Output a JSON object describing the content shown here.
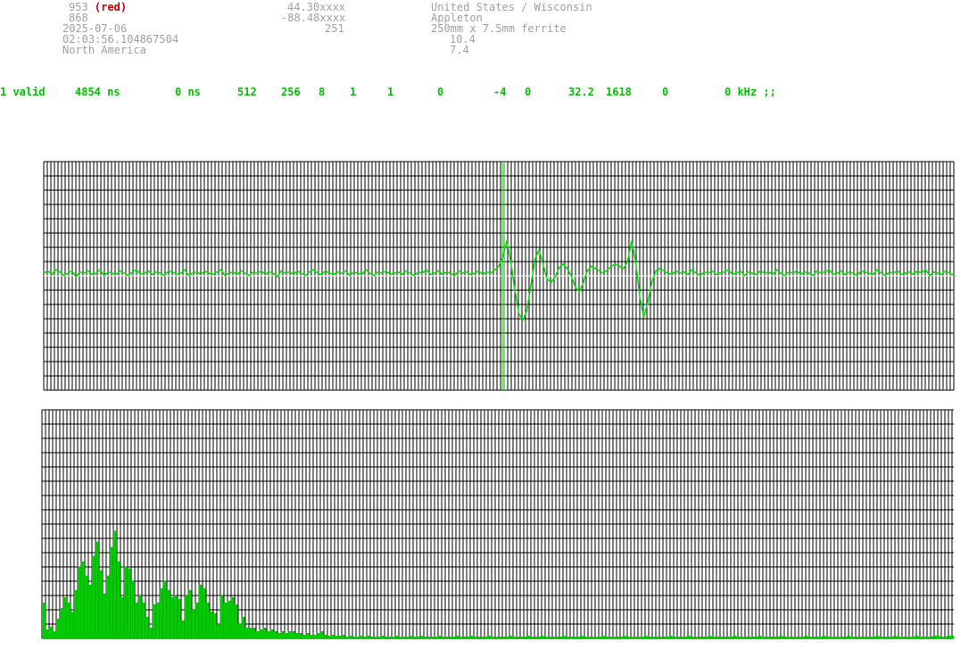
{
  "info": {
    "col1": [
      "953",
      "868",
      "2025-07-06",
      "02:03:56.104867504",
      "North America"
    ],
    "col1_flag": "(red)",
    "col2": [
      "44.30xxxx",
      "-88.48xxxx",
      "251"
    ],
    "col3": [
      "United States / Wisconsin",
      "Appleton",
      "250mm x 7.5mm ferrite",
      "10.4",
      "7.4"
    ]
  },
  "status": [
    "1 valid",
    "4854 ns",
    "0 ns",
    "512",
    "256",
    "8",
    "1",
    "1",
    "0",
    "-4",
    "0",
    "32.2",
    "1618",
    "0",
    "0 kHz ;;"
  ],
  "colors": {
    "grid": "#000000",
    "signal": "#00dd00",
    "bar": "#00cc00",
    "info": "#a0a0a0",
    "status": "#00c000",
    "flag": "#cc0000"
  },
  "waveform": {
    "samples": [
      0,
      2,
      -1,
      3,
      1,
      -2,
      0,
      2,
      -3,
      1,
      0,
      2,
      -1,
      0,
      3,
      -2,
      1,
      0,
      -1,
      2,
      0,
      -2,
      1,
      3,
      -1,
      0,
      2,
      -1,
      1,
      0,
      -2,
      2,
      1,
      -1,
      0,
      3,
      -2,
      0,
      1,
      -1,
      2,
      0,
      -1,
      1,
      3,
      -2,
      0,
      1,
      -1,
      2,
      0,
      -2,
      1,
      0,
      2,
      -1,
      1,
      0,
      -3,
      2,
      0,
      1,
      -1,
      2,
      0,
      -2,
      1,
      3,
      0,
      -1,
      2,
      0,
      -1,
      1,
      0,
      2,
      -2,
      1,
      0,
      -1,
      3,
      0,
      -2,
      1,
      0,
      2,
      -1,
      0,
      1,
      -1,
      2,
      0,
      -2,
      1,
      0,
      3,
      -1,
      0,
      2,
      -1,
      1,
      0,
      -2,
      2,
      0,
      1,
      -1,
      0,
      2,
      -1,
      1,
      0,
      3,
      6,
      14,
      28,
      10,
      -15,
      -35,
      -40,
      -32,
      -10,
      12,
      20,
      8,
      -5,
      -8,
      -3,
      5,
      8,
      4,
      -2,
      -12,
      -16,
      -8,
      2,
      6,
      4,
      2,
      0,
      3,
      6,
      8,
      6,
      4,
      10,
      28,
      10,
      -20,
      -38,
      -25,
      -8,
      2,
      4,
      2,
      0,
      -1,
      2,
      0,
      1,
      -1,
      3,
      0,
      -2,
      1,
      0,
      2,
      -1,
      0,
      1,
      3,
      -1,
      0,
      2,
      -2,
      1,
      0,
      -1,
      2,
      0,
      1,
      -1,
      3,
      0,
      -2,
      1,
      0,
      2,
      -1,
      1,
      0,
      -2,
      2,
      0,
      1,
      3,
      -1,
      0,
      2,
      -1,
      1,
      0,
      -2,
      2,
      1,
      0,
      -1,
      3,
      0,
      -2,
      1,
      0,
      2,
      -1,
      0,
      1,
      -1,
      2,
      0,
      3,
      -2,
      1,
      0,
      -1,
      2,
      0,
      -2
    ],
    "marker_fraction": 0.505
  },
  "spectrum": {
    "values": [
      40,
      10,
      13,
      8,
      22,
      34,
      46,
      40,
      30,
      54,
      80,
      86,
      70,
      60,
      92,
      108,
      76,
      50,
      70,
      102,
      120,
      86,
      46,
      80,
      78,
      64,
      40,
      48,
      40,
      24,
      12,
      38,
      40,
      56,
      64,
      54,
      46,
      48,
      44,
      20,
      48,
      54,
      32,
      40,
      60,
      56,
      40,
      30,
      28,
      16,
      48,
      40,
      42,
      46,
      38,
      16,
      24,
      12,
      12,
      12,
      8,
      10,
      12,
      8,
      10,
      8,
      6,
      8,
      6,
      8,
      8,
      6,
      6,
      4,
      6,
      4,
      4,
      6,
      8,
      4,
      3,
      4,
      3,
      3,
      4,
      2,
      3,
      2,
      2,
      3,
      2,
      3,
      2,
      2,
      2,
      3,
      2,
      2,
      2,
      3,
      2,
      2,
      2,
      3,
      2,
      2,
      3,
      2,
      2,
      2,
      2,
      3,
      2,
      2,
      2,
      2,
      3,
      2,
      2,
      2,
      3,
      2,
      2,
      2,
      2,
      3,
      2,
      2,
      2,
      2,
      2,
      3,
      2,
      2,
      2,
      2,
      3,
      2,
      2,
      2,
      3,
      2,
      2,
      2,
      2,
      2,
      3,
      2,
      2,
      2,
      2,
      3,
      2,
      2,
      2,
      2,
      2,
      3,
      2,
      2,
      2,
      2,
      2,
      3,
      2,
      2,
      2,
      2,
      2,
      3,
      2,
      2,
      2,
      2,
      2,
      2,
      3,
      2,
      2,
      2,
      2,
      3,
      2,
      2,
      2,
      2,
      2,
      3,
      2,
      2,
      2,
      2,
      2,
      2,
      3,
      2,
      2,
      2,
      2,
      2,
      2,
      3,
      2,
      2,
      2,
      2,
      2,
      3,
      2,
      2,
      2,
      2,
      2,
      2,
      3,
      2,
      2,
      2,
      2,
      3,
      2,
      2,
      2,
      2,
      2,
      2,
      3,
      2,
      2,
      2,
      2,
      2,
      2,
      2,
      3,
      2,
      2,
      2,
      2,
      3,
      2,
      2,
      2,
      2,
      2,
      3,
      2,
      2,
      2,
      2,
      3,
      3,
      2,
      2,
      3,
      3
    ],
    "max": 255
  }
}
